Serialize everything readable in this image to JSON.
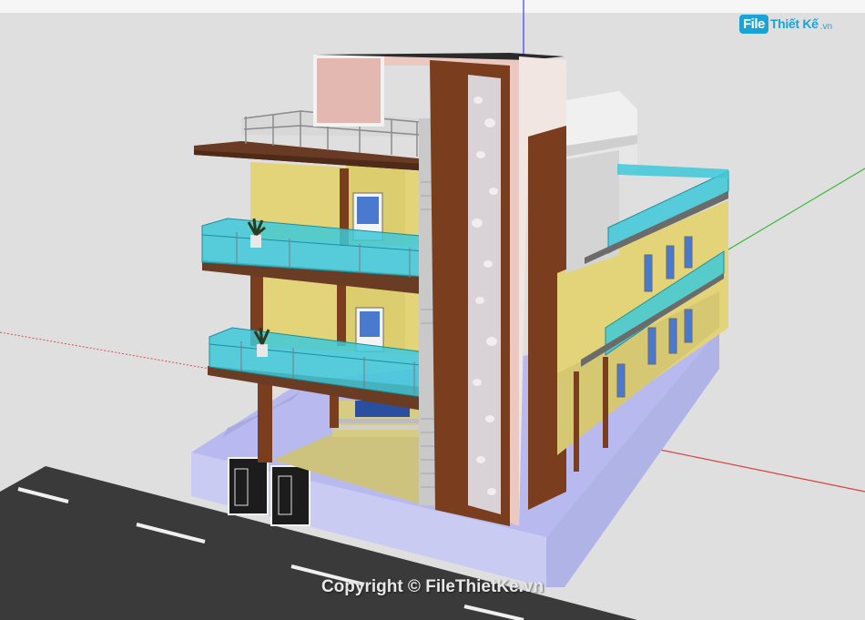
{
  "logo": {
    "file": "File",
    "rest": "Thiết Kế",
    "tld": ".vn"
  },
  "watermark": {
    "text": "Copyright © FileThietKe.vn"
  },
  "colors": {
    "background": "#dfdfdf",
    "facade_yellow": "#e3d47a",
    "wood_brown": "#7a3d1e",
    "glass_cyan": "#3ec8d8",
    "wall_lavender": "#c9cbf2",
    "road": "#3a3a3a",
    "brand": "#1aa3d6"
  },
  "icons": [
    "axis-blue-icon",
    "axis-red-icon",
    "axis-green-icon",
    "potted-plant-icon"
  ]
}
